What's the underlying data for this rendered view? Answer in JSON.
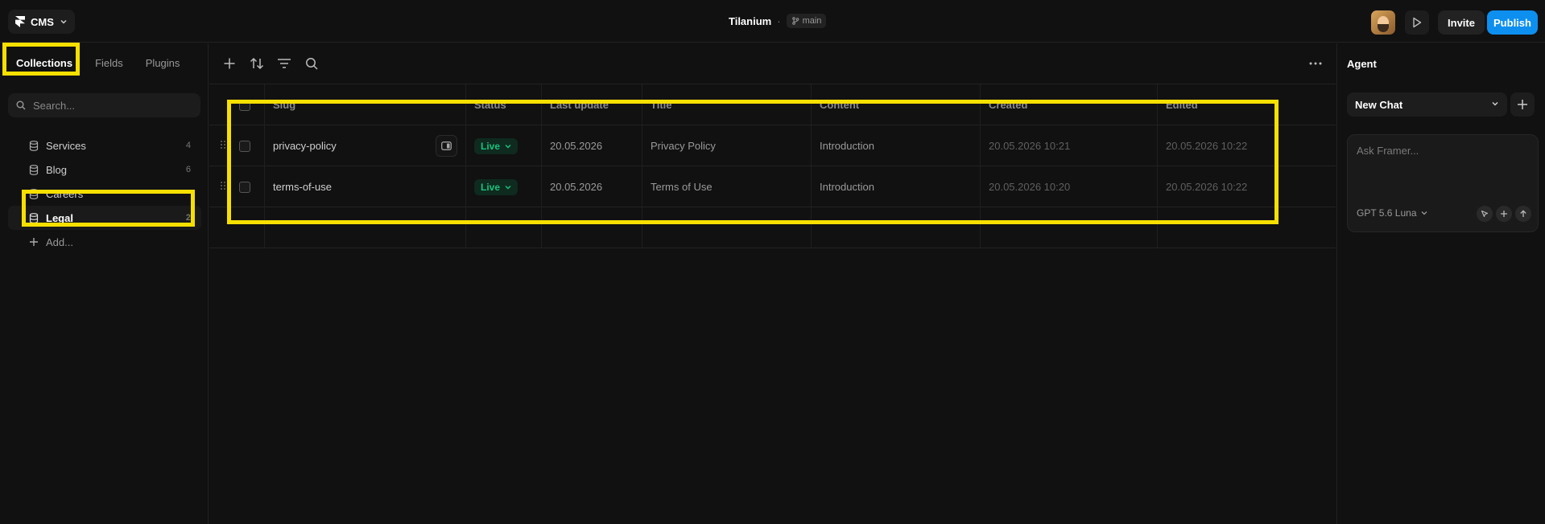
{
  "topbar": {
    "app_label": "CMS",
    "project_name": "Tilanium",
    "separator": "·",
    "branch": "main",
    "invite_label": "Invite",
    "publish_label": "Publish",
    "publish_color": "#0d8ff0"
  },
  "sidebar": {
    "tabs": [
      {
        "label": "Collections",
        "active": true
      },
      {
        "label": "Fields",
        "active": false
      },
      {
        "label": "Plugins",
        "active": false
      }
    ],
    "search_placeholder": "Search...",
    "collections": [
      {
        "name": "Services",
        "count": "4",
        "icon": "database-icon"
      },
      {
        "name": "Blog",
        "count": "6",
        "icon": "database-icon"
      },
      {
        "name": "Careers",
        "count": "",
        "icon": "database-icon"
      },
      {
        "name": "Legal",
        "count": "2",
        "icon": "database-icon",
        "selected": true
      }
    ],
    "add_label": "Add..."
  },
  "table": {
    "columns": [
      "Slug",
      "Status",
      "Last update",
      "Title",
      "Content",
      "Created",
      "Edited"
    ],
    "rows": [
      {
        "slug": "privacy-policy",
        "status": "Live",
        "last_update": "20.05.2026",
        "title": "Privacy Policy",
        "content": "Introduction",
        "created": "20.05.2026 10:21",
        "edited": "20.05.2026 10:22"
      },
      {
        "slug": "terms-of-use",
        "status": "Live",
        "last_update": "20.05.2026",
        "title": "Terms of Use",
        "content": "Introduction",
        "created": "20.05.2026 10:20",
        "edited": "20.05.2026 10:22"
      }
    ],
    "status_color": "#19c37d"
  },
  "agent": {
    "title": "Agent",
    "chat_select": "New Chat",
    "placeholder": "Ask Framer...",
    "model": "GPT 5.6 Luna"
  },
  "highlight_color": "#f7e000"
}
